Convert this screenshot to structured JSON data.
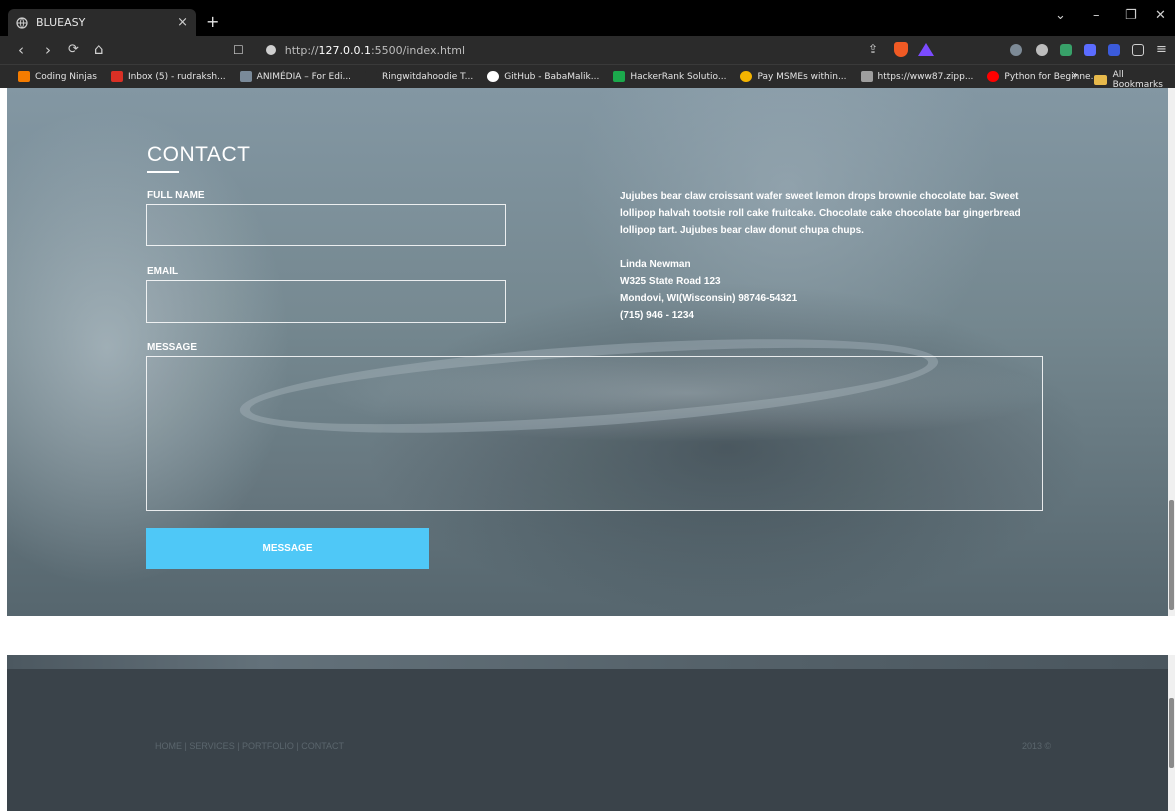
{
  "browser": {
    "tab_title": "BLUEASY",
    "tab_close": "×",
    "new_tab": "+",
    "url_prefix": "http://",
    "url_host": "127.0.0.1",
    "url_path": ":5500/index.html",
    "controls": {
      "dropdown": "⌄",
      "minimize": "–",
      "restore": "❐",
      "close": "✕"
    },
    "nav": {
      "back": "‹",
      "forward": "›",
      "reload": "⟳",
      "home": "⌂",
      "bookmark": "☐"
    }
  },
  "bookmarks": {
    "items": [
      {
        "label": "Coding Ninjas",
        "color": "#f57c00"
      },
      {
        "label": "Inbox (5) - rudraksh...",
        "color": "#d93025"
      },
      {
        "label": "ANIMÉDIA – For Edi...",
        "color": "#7a8a99"
      },
      {
        "label": "Ringwitdahoodie T...",
        "color": "#2b2b2b"
      },
      {
        "label": "GitHub - BabaMalik...",
        "color": "#ffffff"
      },
      {
        "label": "HackerRank Solutio...",
        "color": "#1ba94c"
      },
      {
        "label": "Pay MSMEs within...",
        "color": "#f4b400"
      },
      {
        "label": "https://www87.zipp...",
        "color": "#9e9e9e"
      },
      {
        "label": "Python for Beginne...",
        "color": "#ff0000"
      }
    ],
    "more": "»",
    "all_label": "All Bookmarks"
  },
  "contact": {
    "title": "CONTACT",
    "fields": {
      "full_name_label": "FULL NAME",
      "email_label": "EMAIL",
      "message_label": "MESSAGE",
      "full_name_value": "",
      "email_value": "",
      "message_value": ""
    },
    "submit_label": "MESSAGE",
    "about_text": "Jujubes bear claw croissant wafer sweet lemon drops brownie chocolate bar. Sweet lollipop halvah tootsie roll cake fruitcake. Chocolate cake chocolate bar gingerbread lollipop tart. Jujubes bear claw donut chupa chups.",
    "address": {
      "name": "Linda Newman",
      "street": "W325 State Road 123",
      "city": "Mondovi, WI(Wisconsin) 98746-54321",
      "phone": "(715) 946 - 1234"
    }
  },
  "footer": {
    "links": "HOME | SERVICES | PORTFOLIO | CONTACT",
    "copyright": "2013 ©"
  },
  "colors": {
    "accent_button": "#4fc8f7",
    "footer_bg": "#3a434a",
    "footer_text": "#5b666d"
  }
}
